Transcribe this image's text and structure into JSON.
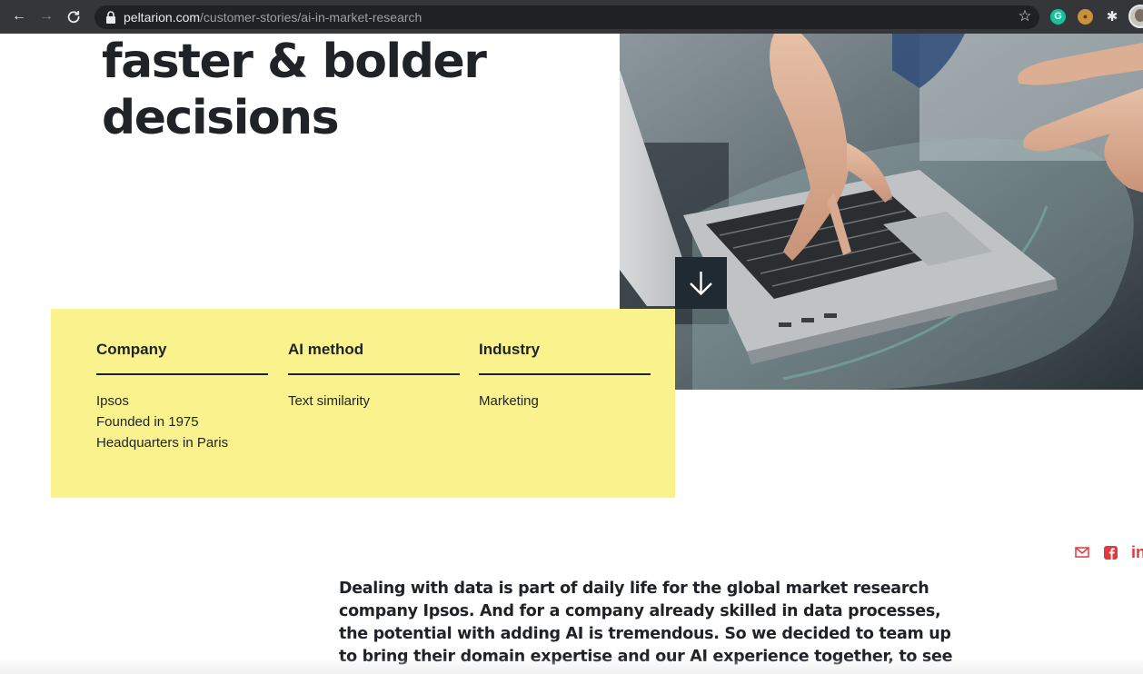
{
  "browser": {
    "url_domain": "peltarion.com",
    "url_path": "/customer-stories/ai-in-market-research",
    "extensions": [
      "grammarly-icon",
      "cookie-icon",
      "puzzle-icon"
    ],
    "grammarly_letter": "G"
  },
  "hero": {
    "headline_lines": [
      "faster & bolder",
      "decisions"
    ]
  },
  "facts": {
    "background": "#faf28c",
    "columns": [
      {
        "heading": "Company",
        "lines": [
          "Ipsos",
          "Founded in 1975",
          "Headquarters in Paris"
        ]
      },
      {
        "heading": "AI method",
        "lines": [
          "Text similarity"
        ]
      },
      {
        "heading": "Industry",
        "lines": [
          "Marketing"
        ]
      }
    ]
  },
  "share": {
    "color": "#e0393e",
    "icons": [
      "mail-icon",
      "facebook-icon",
      "linkedin-icon"
    ],
    "linkedin_glyph": "in"
  },
  "article": {
    "intro_lines": [
      "Dealing with data is part of daily life for the global market research",
      "company Ipsos. And for a company already skilled in data processes,",
      "the potential with adding AI is tremendous. So we decided to team up",
      "to bring their domain expertise and our AI experience together, to see"
    ]
  }
}
